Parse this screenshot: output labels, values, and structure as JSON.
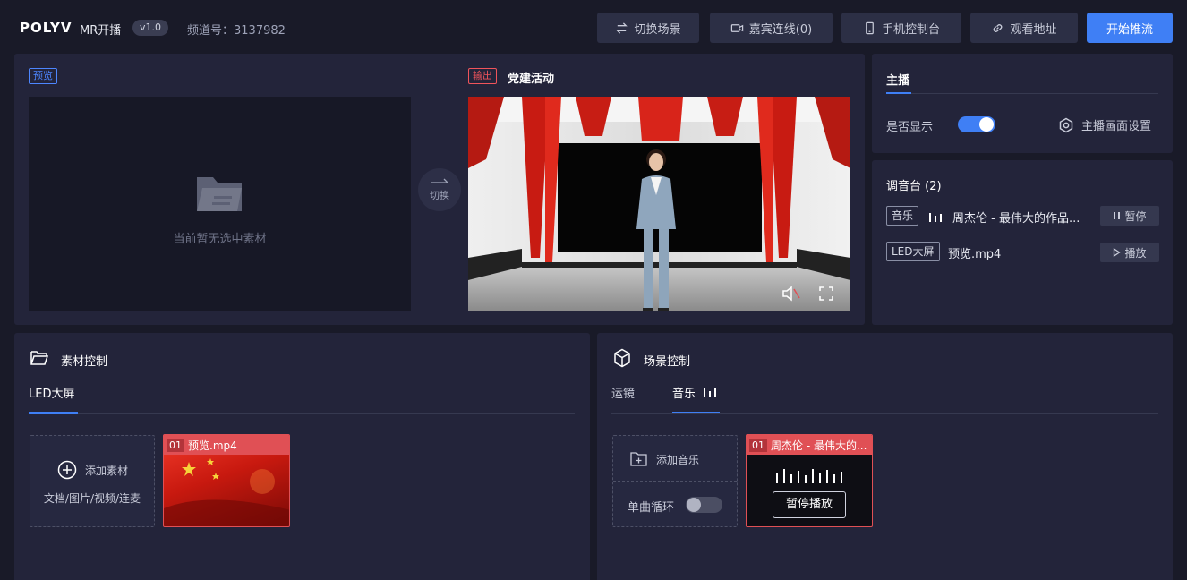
{
  "header": {
    "logo": "POLYV",
    "app_name": "MR开播",
    "version": "v1.0",
    "channel": "频道号：3137982",
    "buttons": {
      "switch_scene": "切换场景",
      "guest_link": "嘉宾连线(0)",
      "mobile_console": "手机控制台",
      "watch_url": "观看地址",
      "start_stream": "开始推流"
    }
  },
  "preview": {
    "tag": "预览",
    "empty_text": "当前暂无选中素材"
  },
  "switch": {
    "label": "切换"
  },
  "output": {
    "tag": "输出",
    "title": "党建活动"
  },
  "anchor": {
    "tab": "主播",
    "show_label": "是否显示",
    "show_enabled": true,
    "settings_label": "主播画面设置"
  },
  "mixer": {
    "title": "调音台 (2)",
    "items": [
      {
        "tag": "音乐",
        "name": "周杰伦 - 最伟大的作品...",
        "action": "暂停"
      },
      {
        "tag": "LED大屏",
        "name": "预览.mp4",
        "action": "播放"
      }
    ]
  },
  "material": {
    "title": "素材控制",
    "tab": "LED大屏",
    "add_label": "添加素材",
    "add_hint": "文档/图片/视频/连麦",
    "items": [
      {
        "num": "01",
        "name": "预览.mp4"
      }
    ]
  },
  "scene": {
    "title": "场景控制",
    "tabs": [
      "运镜",
      "音乐"
    ],
    "add_music": "添加音乐",
    "loop_label": "单曲循环",
    "loop_enabled": false,
    "music_items": [
      {
        "num": "01",
        "name": "周杰伦 - 最伟大的...",
        "action": "暂停播放"
      }
    ]
  },
  "colors": {
    "accent": "#3f7ff5",
    "danger": "#e05055",
    "panel": "#23243a",
    "background": "#191a28"
  }
}
